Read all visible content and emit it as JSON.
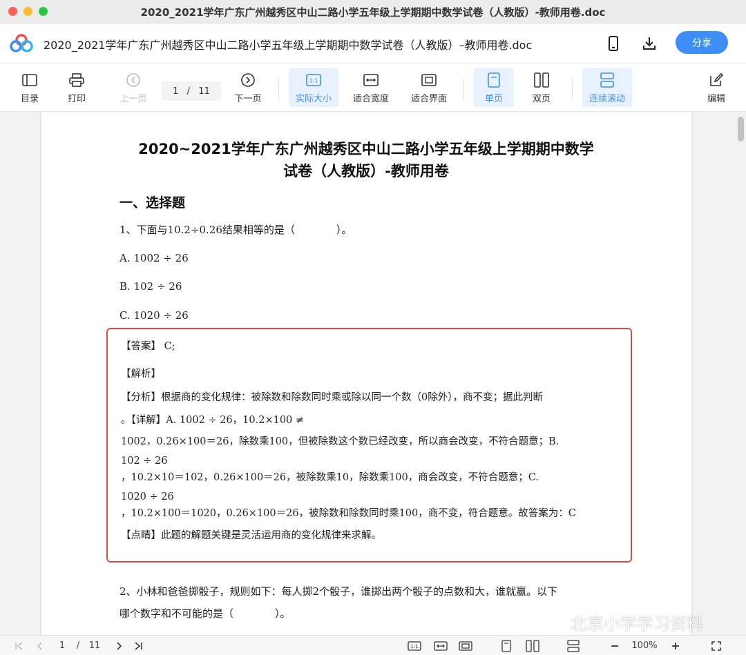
{
  "window": {
    "title": "2020_2021学年广东广州越秀区中山二路小学五年级上学期期中数学试卷（人教版）-教师用卷.doc"
  },
  "header": {
    "doc_title": "2020_2021学年广东广州越秀区中山二路小学五年级上学期期中数学试卷（人教版）–教师用卷.doc",
    "share_label": "分享"
  },
  "toolbar": {
    "toc": "目录",
    "print": "打印",
    "prev": "上一页",
    "page_current": "1",
    "page_sep": "/",
    "page_total": "11",
    "next": "下一页",
    "actual_size": "实际大小",
    "fit_width": "适合宽度",
    "fit_window": "适合界面",
    "single_page": "单页",
    "double_page": "双页",
    "continuous": "连续滚动",
    "edit": "编辑"
  },
  "document": {
    "title_line1": "2020~2021学年广东广州越秀区中山二路小学五年级上学期期中数学",
    "title_line2": "试卷（人教版）-教师用卷",
    "section1": "一、选择题",
    "q1": "1、下面与10.2÷0.26结果相等的是（　　　　）。",
    "q1_a": "A.  1002  ÷  26",
    "q1_b": "B.  102  ÷  26",
    "q1_c": "C.  1020  ÷  26",
    "answer": {
      "line1": "【答案】 C;",
      "line2": "【解析】",
      "line3": "【分析】根据商的变化规律：被除数和除数同时乘或除以同一个数（0除外），商不变；据此判断",
      "line4": "。【详解】A.  1002  ÷  26，10.2×100  ≠",
      "line5": "1002，0.26×100＝26，除数乘100，但被除数这个数已经改变，所以商会改变，不符合题意；B.",
      "line6": "102  ÷  26",
      "line7": "，10.2×10＝102，0.26×100＝26，被除数乘10，除数乘100，商会改变，不符合题意；C.",
      "line8": "1020  ÷  26",
      "line9": "，10.2×100＝1020，0.26×100＝26，被除数和除数同时乘100，商不变，符合题意。故答案为：C",
      "line10": "【点睛】此题的解题关键是灵活运用商的变化规律来求解。"
    },
    "q2_line1": "2、小林和爸爸掷骰子，规则如下：每人掷2个骰子，谁掷出两个骰子的点数和大，谁就赢。以下",
    "q2_line2": "哪个数字和不可能的是（　　　　）。"
  },
  "statusbar": {
    "page_current": "1",
    "page_sep": "/",
    "page_total": "11",
    "zoom": "100%"
  },
  "watermark": "北京小学学习资料",
  "colors": {
    "accent": "#3d8ef7",
    "highlight_border": "#e34a3f"
  }
}
